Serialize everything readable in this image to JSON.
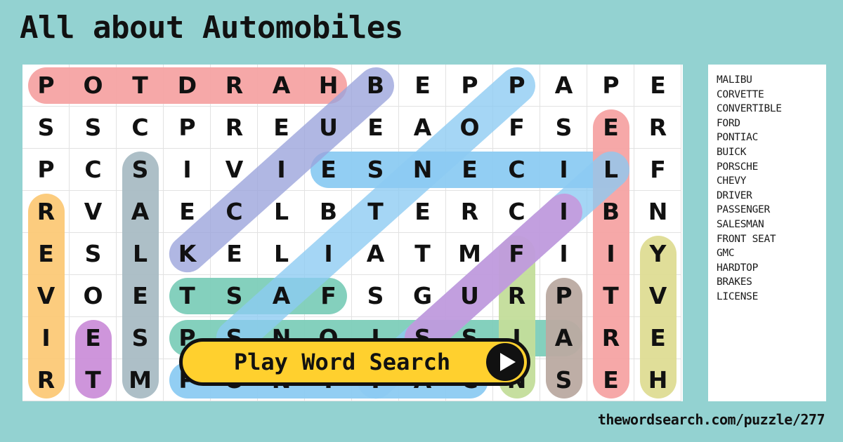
{
  "title": "All about Automobiles",
  "site_url": "thewordsearch.com/puzzle/277",
  "play_button": {
    "label": "Play Word Search",
    "icon": "play-triangle-icon"
  },
  "colors": {
    "background": "#93d2d1",
    "panel": "#ffffff",
    "grid_line": "#e2e2e2",
    "letter": "#111111",
    "button_fill": "#ffd02e",
    "button_border": "#111111",
    "hl_salmon": "#f5a3a3",
    "hl_periwinkle": "#9aa3db",
    "hl_lightblue": "#8ccbf2",
    "hl_gray": "#a9bcc4",
    "hl_orange": "#fcc977",
    "hl_teal": "#7dcdb9",
    "hl_purple": "#cb8fd9",
    "hl_green": "#c3dd9a",
    "hl_yellow": "#dedc94",
    "hl_brown": "#bbaaa1"
  },
  "grid": {
    "columns": 14,
    "rows": 8,
    "letters": [
      [
        "P",
        "O",
        "T",
        "D",
        "R",
        "A",
        "H",
        "B",
        "E",
        "P",
        "P",
        "A",
        "P",
        "E"
      ],
      [
        "S",
        "S",
        "C",
        "P",
        "R",
        "E",
        "U",
        "E",
        "A",
        "O",
        "F",
        "S",
        "E",
        "R"
      ],
      [
        "P",
        "C",
        "S",
        "I",
        "V",
        "I",
        "E",
        "S",
        "N",
        "E",
        "C",
        "I",
        "L",
        "F"
      ],
      [
        "R",
        "V",
        "A",
        "E",
        "C",
        "L",
        "B",
        "T",
        "E",
        "R",
        "C",
        "I",
        "B",
        "N"
      ],
      [
        "E",
        "S",
        "L",
        "K",
        "E",
        "L",
        "I",
        "A",
        "T",
        "M",
        "F",
        "I",
        "I",
        "Y"
      ],
      [
        "V",
        "O",
        "E",
        "T",
        "S",
        "A",
        "F",
        "S",
        "G",
        "U",
        "R",
        "P",
        "T",
        "V"
      ],
      [
        "I",
        "E",
        "S",
        "P",
        "S",
        "N",
        "O",
        "I",
        "S",
        "S",
        "I",
        "A",
        "R",
        "E"
      ],
      [
        "R",
        "T",
        "M",
        "P",
        "O",
        "N",
        "T",
        "I",
        "A",
        "C",
        "N",
        "S",
        "E",
        "H"
      ]
    ]
  },
  "word_list": [
    "MALIBU",
    "CORVETTE",
    "CONVERTIBLE",
    "FORD",
    "PONTIAC",
    "BUICK",
    "PORSCHE",
    "CHEVY",
    "DRIVER",
    "PASSENGER",
    "SALESMAN",
    "FRONT SEAT",
    "GMC",
    "HARDTOP",
    "BRAKES",
    "LICENSE"
  ],
  "highlights": [
    {
      "word": "HARDTOP",
      "color": "#f5a3a3",
      "type": "horizontal",
      "row": 0,
      "col_start": 0,
      "col_end": 6
    },
    {
      "word": "LICENSE",
      "color": "#8ccbf2",
      "type": "horizontal",
      "row": 2,
      "col_start": 6,
      "col_end": 12
    },
    {
      "word": "FRONT SEAT",
      "color": "#7dcdb9",
      "type": "horizontal",
      "row": 5,
      "col_start": 3,
      "col_end": 6
    },
    {
      "word": "PASSENGER",
      "color": "#7dcdb9",
      "type": "horizontal",
      "row": 6,
      "col_start": 3,
      "col_end": 11
    },
    {
      "word": "PONTIAC",
      "color": "#8ccbf2",
      "type": "horizontal",
      "row": 7,
      "col_start": 3,
      "col_end": 9
    },
    {
      "word": "CONVERTIBLE",
      "color": "#f5a3a3",
      "type": "vertical",
      "col": 12,
      "row_start": 1,
      "row_end": 7
    },
    {
      "word": "DRIVER",
      "color": "#fcc977",
      "type": "vertical",
      "col": 0,
      "row_start": 3,
      "row_end": 7
    },
    {
      "word": "SALESMAN",
      "color": "#a9bcc4",
      "type": "vertical",
      "col": 2,
      "row_start": 2,
      "row_end": 7
    },
    {
      "word": "CHEVY",
      "color": "#dedc94",
      "type": "vertical",
      "col": 13,
      "row_start": 4,
      "row_end": 7
    },
    {
      "word": "FORD",
      "color": "#c3dd9a",
      "type": "vertical",
      "col": 10,
      "row_start": 4,
      "row_end": 7
    },
    {
      "word": "GMC",
      "color": "#cb8fd9",
      "type": "vertical",
      "col": 1,
      "row_start": 6,
      "row_end": 7
    },
    {
      "word": "BUICK",
      "color": "#9aa3db",
      "type": "diagonal",
      "row_start": 0,
      "col_start": 7,
      "row_end": 4,
      "col_end": 3
    },
    {
      "word": "PORSCHE",
      "color": "#8ccbf2",
      "type": "diagonal",
      "row_start": 0,
      "col_start": 10,
      "row_end": 6,
      "col_end": 4
    },
    {
      "word": "MALIBU",
      "color": "#8ccbf2",
      "type": "diagonal",
      "row_start": 2,
      "col_start": 12,
      "row_end": 7,
      "col_end": 7
    },
    {
      "word": "CORVETTE",
      "color": "#cb8fd9",
      "type": "diagonal",
      "row_start": 3,
      "col_start": 11,
      "row_end": 6,
      "col_end": 8
    },
    {
      "word": "BRAKES",
      "color": "#bbaaa1",
      "type": "vertical",
      "col": 11,
      "row_start": 5,
      "row_end": 7
    }
  ]
}
